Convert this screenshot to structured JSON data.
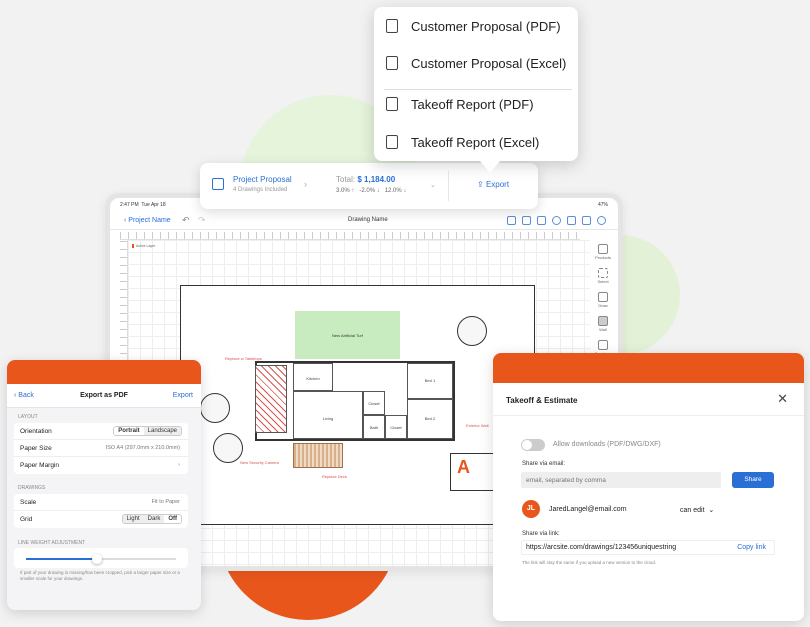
{
  "colors": {
    "accent": "#2a6fd6",
    "brand": "#e8561c",
    "turf": "#c8ecc0"
  },
  "export_menu": {
    "items": [
      {
        "label": "Customer Proposal (PDF)",
        "icon": "person-doc-icon"
      },
      {
        "label": "Customer Proposal (Excel)",
        "icon": "person-doc-icon"
      },
      {
        "label": "Takeoff Report (PDF)",
        "icon": "report-doc-icon"
      },
      {
        "label": "Takeoff Report (Excel)",
        "icon": "report-doc-icon"
      }
    ]
  },
  "project": {
    "title": "Project Proposal",
    "subtitle": "4 Drawings Included",
    "total_label": "Total:",
    "total_value": "$ 1,184.00",
    "pct1": "3.0%",
    "pct2": "-2.0%",
    "pct3": "12.0%",
    "export_label": "Export"
  },
  "tablet": {
    "time": "2:47 PM",
    "date": "Tue Apr 18",
    "battery": "47%",
    "back_label": "Project Name",
    "drawing_name": "Drawing Name",
    "sidebar": [
      "Products",
      "Select",
      "Draw",
      "Wall",
      "Openings"
    ],
    "layer_note": "Active Layer",
    "plan": {
      "turf": "New Artificial Turf",
      "replace_tabletops": "Replace w Tabletops",
      "replace_deck": "Replace Deck",
      "security": "New Security Camera",
      "exterior": "Exterior Wall",
      "rooms": [
        "Kitchen",
        "Bed 1",
        "Bed 2",
        "Living",
        "Closet",
        "Closet",
        "Bath"
      ]
    }
  },
  "pdf_panel": {
    "back": "Back",
    "title": "Export as PDF",
    "export": "Export",
    "layout_label": "LAYOUT",
    "orientation_label": "Orientation",
    "orientation_options": [
      "Portrait",
      "Landscape"
    ],
    "paper_size_label": "Paper Size",
    "paper_size_value": "ISO A4 (297.0mm x 210.0mm)",
    "paper_margin_label": "Paper Margin",
    "drawings_label": "DRAWINGS",
    "scale_label": "Scale",
    "scale_value": "Fit to Paper",
    "grid_label": "Grid",
    "grid_options": [
      "Light",
      "Dark",
      "Off"
    ],
    "line_weight_label": "LINE WEIGHT ADJUSTMENT",
    "line_weight_level": 0.47,
    "note": "If part of your drawing is missing/has been cropped, pick a larger paper size or a smaller scale for your drawings."
  },
  "te_panel": {
    "title": "Takeoff & Estimate",
    "allow_downloads": "Allow downloads (PDF/DWG/DXF)",
    "share_email_label": "Share via email:",
    "email_placeholder": "email, separated by comma",
    "share_btn": "Share",
    "avatar_initials": "JL",
    "user_email": "JaredLangel@email.com",
    "permission": "can edit",
    "share_link_label": "Share via link:",
    "link_url": "https://arcsite.com/drawings/123456uniquestring",
    "copy_link": "Copy link",
    "link_note": "The link will stay the same if you upload a new version to the cloud."
  }
}
